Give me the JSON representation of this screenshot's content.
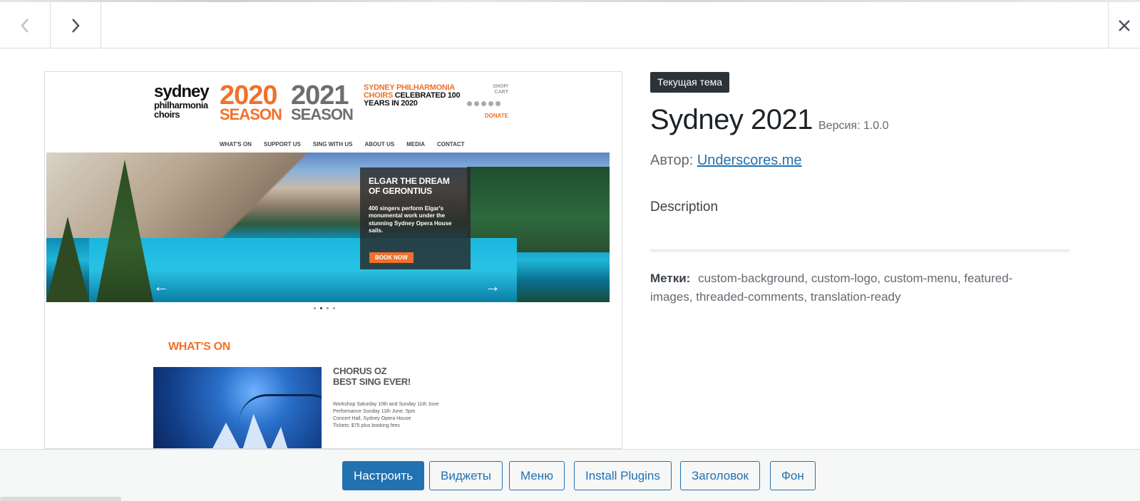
{
  "toolbar": {
    "prev_icon": "chevron-left-icon",
    "next_icon": "chevron-right-icon",
    "close_icon": "close-icon"
  },
  "preview": {
    "logo": {
      "line1": "sydney",
      "line2": "philharmonia",
      "line3": "choirs"
    },
    "season_2020": {
      "year": "2020",
      "word": "SEASON"
    },
    "season_2021": {
      "year": "2021",
      "word": "SEASON"
    },
    "celebrated": {
      "orange": "SYDNEY PHILHARMONIA CHOIRS",
      "dark": " CELEBRATED 100 YEARS IN 2020"
    },
    "shop": "SHOP/ CART",
    "donate": "DONATE",
    "menu": [
      "WHAT'S ON",
      "SUPPORT US",
      "SING WITH US",
      "ABOUT US",
      "MEDIA",
      "CONTACT"
    ],
    "hero": {
      "title": "ELGAR THE DREAM OF GERONTIUS",
      "description": "400 singers perform Elgar's monumental work under the stunning Sydney Opera House sails.",
      "button": "BOOK NOW"
    },
    "whats_on": "WHAT'S ON",
    "event": {
      "title_line1": "CHORUS OZ",
      "title_line2": "BEST SING EVER!",
      "info": [
        "Workshop Saturday 10th and Sunday 11th June",
        "Performance Sunday 11th June, 5pm",
        "Concert Hall, Sydney Opera House",
        "Tickets: $75 plus booking fees"
      ]
    }
  },
  "details": {
    "badge": "Текущая тема",
    "theme_name": "Sydney 2021",
    "version": "Версия: 1.0.0",
    "author_label": "Автор: ",
    "author_link": "Underscores.me",
    "description": "Description",
    "tags_label": "Метки:",
    "tags_value": "custom-background, custom-logo, custom-menu, featured-images, threaded-comments, translation-ready"
  },
  "footer": {
    "customize": "Настроить",
    "widgets": "Виджеты",
    "menus": "Меню",
    "install_plugins": "Install Plugins",
    "header": "Заголовок",
    "background": "Фон"
  },
  "colors": {
    "accent": "#2271b1",
    "brand_orange": "#f0712b"
  }
}
